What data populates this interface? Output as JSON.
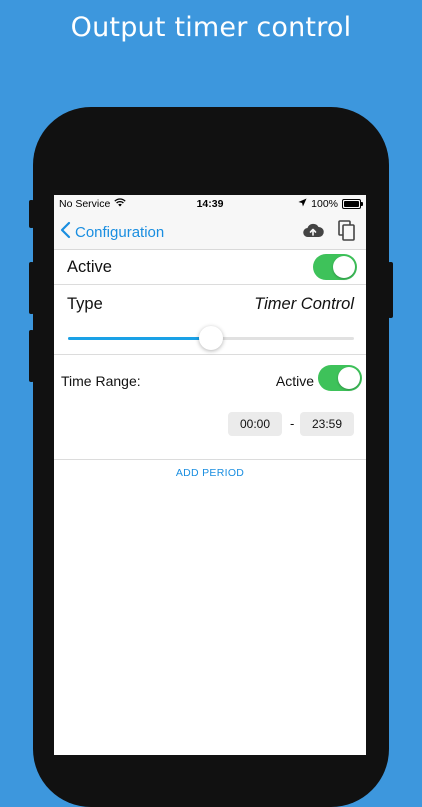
{
  "headline": "Output timer control",
  "status_bar": {
    "carrier": "No Service",
    "time": "14:39",
    "battery": "100%"
  },
  "navbar": {
    "back_label": "Configuration"
  },
  "active_row": {
    "label": "Active",
    "on": true
  },
  "type_row": {
    "label": "Type",
    "value": "Timer Control",
    "slider_level": 0.5
  },
  "time_range": {
    "label": "Time Range:",
    "active_label": "Active",
    "active_on": true,
    "start": "00:00",
    "separator": "-",
    "end": "23:59"
  },
  "add_period_label": "ADD PERIOD",
  "colors": {
    "background": "#3d97dd",
    "accent": "#1a8ee0",
    "toggle_on": "#3ec25a",
    "slider": "#1aa1e6"
  }
}
